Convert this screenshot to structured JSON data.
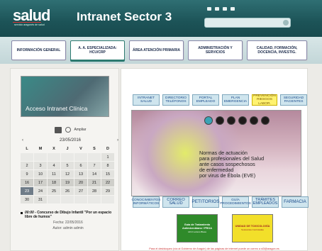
{
  "header": {
    "logo_text": "salud",
    "logo_sub": "servicio aragonés de salud",
    "title": "Intranet Sector 3",
    "icons": [
      "home-icon",
      "mail-icon",
      "sitemap-icon",
      "printer-icon"
    ],
    "search": {
      "placeholder": ""
    }
  },
  "nav": {
    "items": [
      {
        "label": "INFORMACIÓN GENERAL"
      },
      {
        "label": "A. A. ESPECIALIZADA: HCU/CRP"
      },
      {
        "label": "ÁREA ATENCIÓN PRIMARIA"
      },
      {
        "label": "ADMINISTRACIÓN Y SERVICIOS"
      },
      {
        "label": "CALIDAD, FORMACIÓN, DOCENCIA, INVESTIG."
      }
    ]
  },
  "left": {
    "promo": "Acceso Intranet Clínica",
    "calendar": {
      "enlarge": "Ampliar",
      "date": "23/05/2016",
      "days": [
        "L",
        "M",
        "X",
        "J",
        "V",
        "S",
        "D"
      ],
      "cells": [
        "",
        "",
        "",
        "",
        "",
        "",
        "1",
        "2",
        "3",
        "4",
        "5",
        "6",
        "7",
        "8",
        "9",
        "10",
        "11",
        "12",
        "13",
        "14",
        "15",
        "16",
        "17",
        "18",
        "19",
        "20",
        "21",
        "22",
        "23",
        "24",
        "25",
        "26",
        "27",
        "28",
        "29",
        "30",
        "31",
        "",
        "",
        "",
        "",
        ""
      ]
    },
    "event": {
      "time": "00:00",
      "title": "- Concurso de Dibujo Infantil \"Por un espacio libre de humos\"",
      "date": "Fecha: 22/05/2016",
      "author": "Autor: admin admin"
    }
  },
  "right": {
    "top_buttons": [
      {
        "label": "INTRANET SALUD"
      },
      {
        "label": "DIRECTORIO TELÉFONOS"
      },
      {
        "label": "PORTAL EMPLEADO"
      },
      {
        "label": "PLAN EMERGENCIA"
      },
      {
        "label": "PREVENCIÓN RIESGOS LABOR."
      },
      {
        "label": "SEGURIDAD PACIENTES"
      }
    ],
    "carousel": {
      "text_lines": [
        "Normas de actuación",
        "para profesionales del Salud",
        "ante casos sospechosos",
        "de enfermedad",
        "por virus de Ébola (EVE)"
      ],
      "dots": 6,
      "active_dot": 1
    },
    "bottom_buttons": [
      {
        "label": "CONOCIMIENTOS INFORMÁTICOS"
      },
      {
        "label": "CORREO SALUD"
      },
      {
        "label": "PETITORIOS"
      },
      {
        "label": "GUÍA PROCEDIMIENTOS"
      },
      {
        "label": "TRÁMITES EMPLEADOS"
      },
      {
        "label": "FARMACIA"
      }
    ],
    "guides": [
      {
        "line1": "Guía de Tratamiento",
        "line2": "Antimicrobiano / PROA",
        "line3": "HCU Lozano Blesa",
        "color": "#2f8a2a"
      },
      {
        "line1": "UNIDAD DE TOXICOLOGÍA",
        "line2": "Sustancias Controladas",
        "line3": "",
        "color": "#f2df2a"
      }
    ],
    "footer": "Para el desbloqueo (vía al Gobierno de Aragón) de las páginas de internet puede un correo a sl3@aragon.es"
  }
}
